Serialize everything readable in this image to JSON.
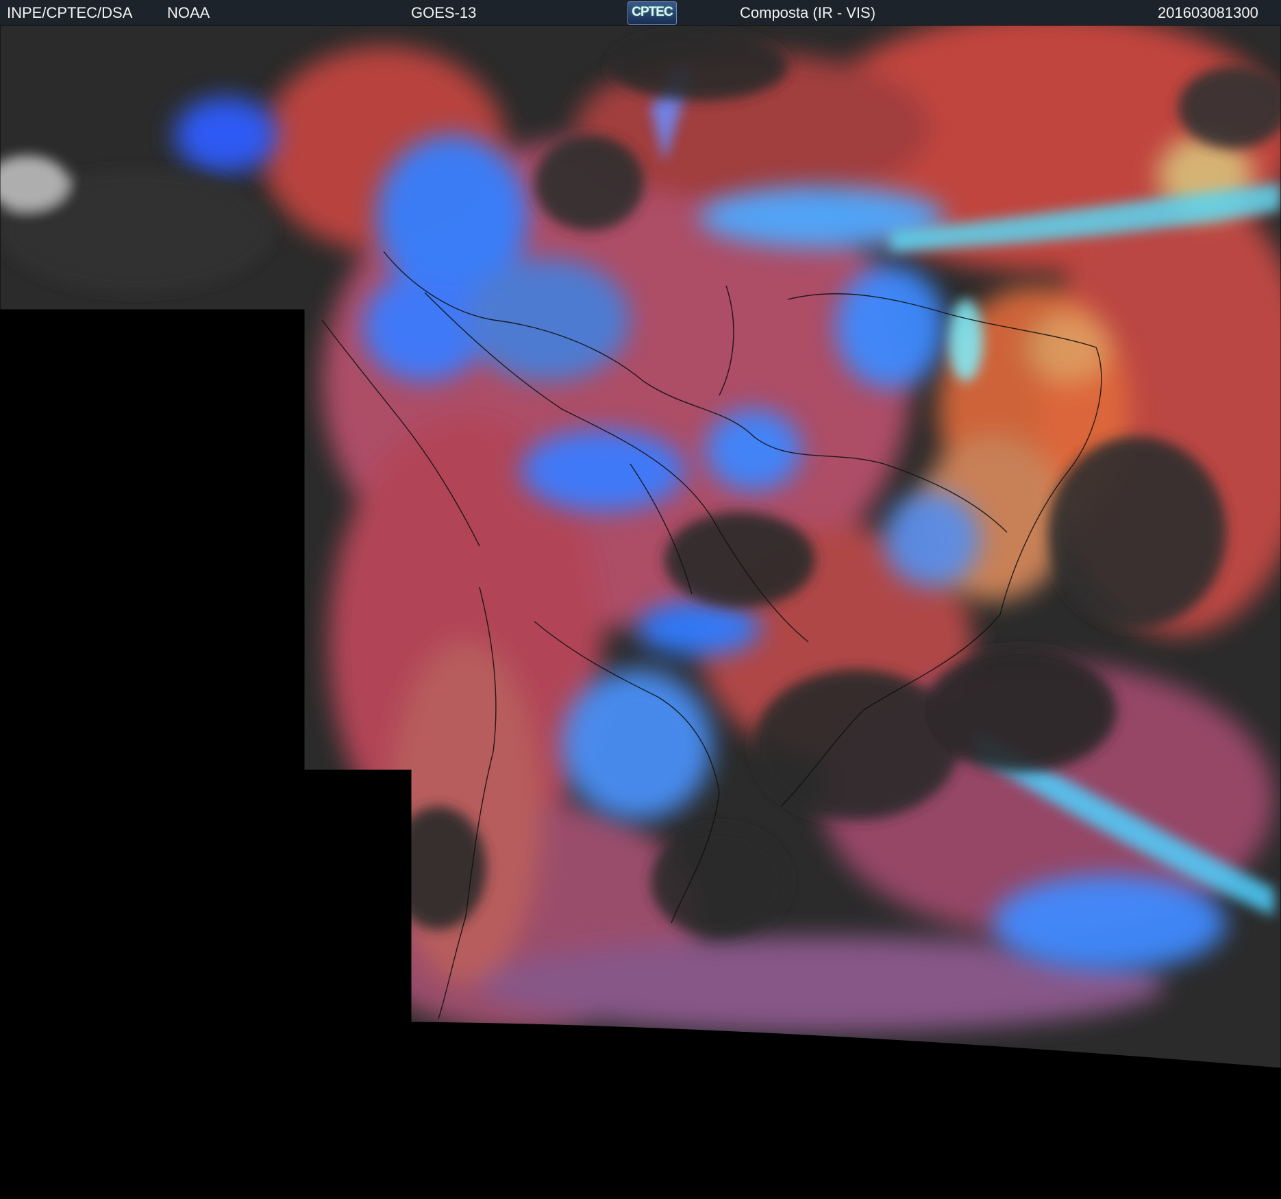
{
  "header": {
    "org": "INPE/CPTEC/DSA",
    "agency": "NOAA",
    "satellite": "GOES-13",
    "logo_text": "CPTEC",
    "product": "Composta (IR - VIS)",
    "timestamp": "201603081300"
  },
  "colors": {
    "header_bg": "#1c232b",
    "background": "#000000",
    "cloud_red": "#c9473f",
    "cloud_blue": "#3b7bff",
    "cloud_cyan": "#4fd0ff",
    "cloud_orange": "#e06a3a",
    "clear_dark": "#2a2a2a",
    "border_line": "#111111"
  }
}
